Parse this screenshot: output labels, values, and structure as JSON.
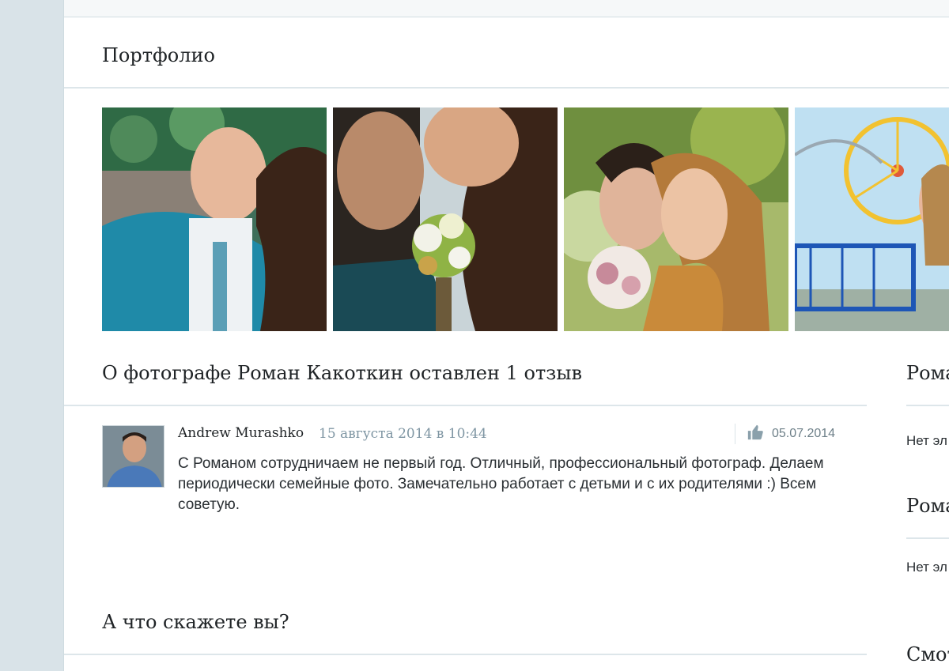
{
  "portfolio": {
    "title": "Портфолио",
    "photos": [
      {
        "alt": "wedding-photo-1"
      },
      {
        "alt": "wedding-photo-2"
      },
      {
        "alt": "wedding-photo-3"
      },
      {
        "alt": "wedding-photo-4"
      }
    ]
  },
  "reviews": {
    "heading": "О фотографе Роман Какоткин оставлен 1 отзыв",
    "items": [
      {
        "author": "Andrew Murashko",
        "date": "15 августа 2014 в 10:44",
        "like_date": "05.07.2014",
        "text": "С Романом сотрудничаем не первый год. Отличный, профессиональный фотограф. Делаем периодически семейные фото. Замечательно работает с детьми и с их родителями :) Всем советую."
      }
    ]
  },
  "feedback": {
    "heading": "А что скажете вы?"
  },
  "sidebar": {
    "block1_title": "Рома",
    "block1_text": "Нет эл",
    "block2_title": "Рома",
    "block2_text": "Нет эл",
    "block3_title": "Смот"
  },
  "colors": {
    "background": "#d9e3e8",
    "panel": "#ffffff",
    "muted_text": "#7f96a3",
    "divider": "#dde6ea"
  }
}
